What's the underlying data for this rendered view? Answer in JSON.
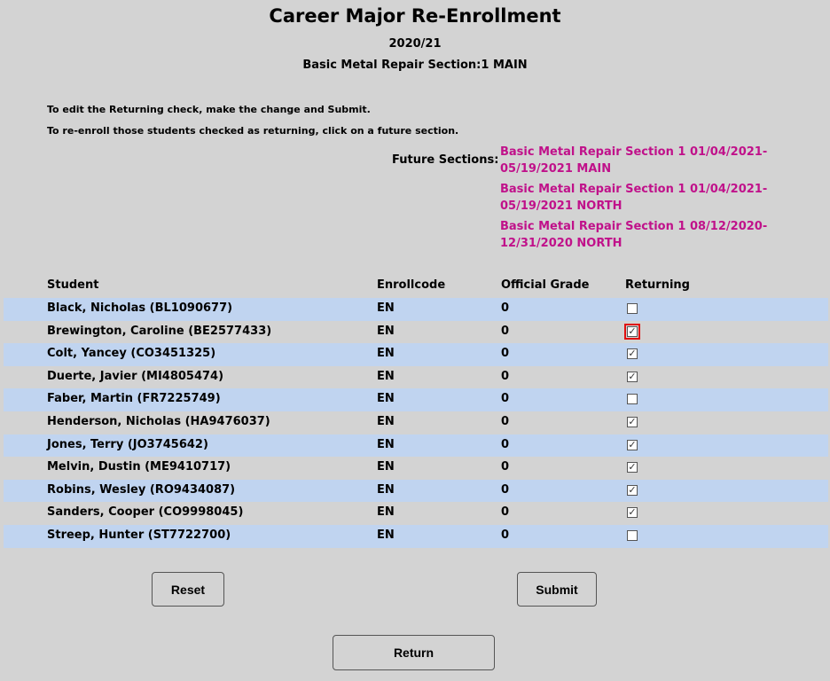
{
  "header": {
    "title": "Career Major Re-Enrollment",
    "year": "2020/21",
    "section": "Basic Metal Repair Section:1 MAIN"
  },
  "instructions": [
    "To edit the Returning check, make the change and Submit.",
    "To re-enroll those students checked as returning, click on a future section."
  ],
  "future": {
    "label": "Future Sections:",
    "sections": [
      "Basic Metal Repair Section 1 01/04/2021-05/19/2021 MAIN",
      "Basic Metal Repair Section 1 01/04/2021-05/19/2021 NORTH",
      "Basic Metal Repair Section 1 08/12/2020-12/31/2020 NORTH"
    ],
    "link_color": "#c0118a"
  },
  "table": {
    "columns": [
      "Student",
      "Enrollcode",
      "Official Grade",
      "Returning"
    ],
    "row_band_color": "#c0d4f0",
    "rows": [
      {
        "student": "Black, Nicholas (BL1090677)",
        "enrollcode": "EN",
        "grade": "0",
        "returning": false
      },
      {
        "student": "Brewington, Caroline (BE2577433)",
        "enrollcode": "EN",
        "grade": "0",
        "returning": true,
        "focused": true
      },
      {
        "student": "Colt, Yancey (CO3451325)",
        "enrollcode": "EN",
        "grade": "0",
        "returning": true
      },
      {
        "student": "Duerte, Javier (MI4805474)",
        "enrollcode": "EN",
        "grade": "0",
        "returning": true
      },
      {
        "student": "Faber, Martin (FR7225749)",
        "enrollcode": "EN",
        "grade": "0",
        "returning": false
      },
      {
        "student": "Henderson, Nicholas (HA9476037)",
        "enrollcode": "EN",
        "grade": "0",
        "returning": true
      },
      {
        "student": "Jones, Terry (JO3745642)",
        "enrollcode": "EN",
        "grade": "0",
        "returning": true
      },
      {
        "student": "Melvin, Dustin (ME9410717)",
        "enrollcode": "EN",
        "grade": "0",
        "returning": true
      },
      {
        "student": "Robins, Wesley (RO9434087)",
        "enrollcode": "EN",
        "grade": "0",
        "returning": true
      },
      {
        "student": "Sanders, Cooper (CO9998045)",
        "enrollcode": "EN",
        "grade": "0",
        "returning": true
      },
      {
        "student": "Streep, Hunter (ST7722700)",
        "enrollcode": "EN",
        "grade": "0",
        "returning": false
      }
    ]
  },
  "buttons": {
    "reset": "Reset",
    "submit": "Submit",
    "return": "Return"
  }
}
